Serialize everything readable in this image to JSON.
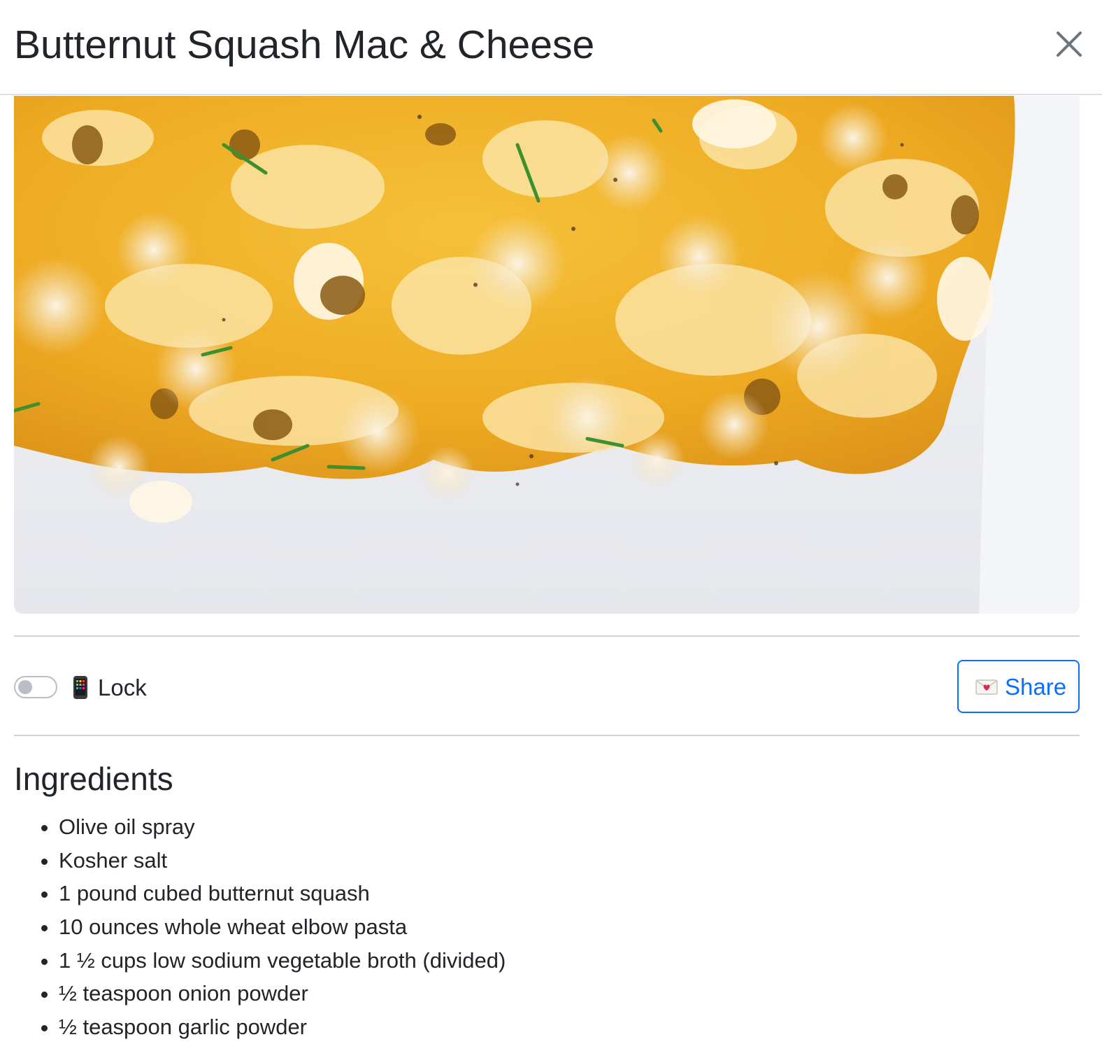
{
  "modal": {
    "title": "Butternut Squash Mac & Cheese",
    "close_icon": "close-icon"
  },
  "photo": {
    "alt": "Butternut squash mac and cheese in a white baking dish"
  },
  "controls": {
    "lock_toggle_on": false,
    "lock_icon": "mobile-phone-icon",
    "lock_label": "Lock",
    "share_icon": "love-letter-icon",
    "share_label": "Share"
  },
  "ingredients": {
    "heading": "Ingredients",
    "items": [
      "Olive oil spray",
      "Kosher salt",
      "1 pound cubed butternut squash",
      "10 ounces whole wheat elbow pasta",
      "1 ½ cups low sodium vegetable broth (divided)",
      "½ teaspoon onion powder",
      "½ teaspoon garlic powder"
    ]
  },
  "colors": {
    "accent": "#0d6efd",
    "text": "#212529",
    "divider": "#dee2e6",
    "toggle_off": "#b9bec4",
    "food_yellow": "#f0b428",
    "dish_white": "#ecedf1"
  }
}
